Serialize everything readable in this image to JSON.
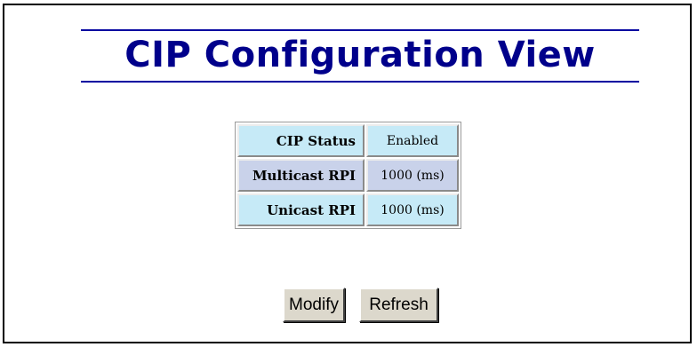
{
  "page": {
    "title": "CIP Configuration View"
  },
  "config_table": {
    "rows": [
      {
        "label": "CIP Status",
        "value": "Enabled"
      },
      {
        "label": "Multicast RPI",
        "value": "1000 (ms)"
      },
      {
        "label": "Unicast RPI",
        "value": "1000 (ms)"
      }
    ]
  },
  "buttons": {
    "modify_label": "Modify",
    "refresh_label": "Refresh"
  },
  "colors": {
    "title": "#00008b",
    "row_odd": "#c6eaf7",
    "row_even": "#c9d2ea",
    "button_face": "#dcd8cc"
  }
}
